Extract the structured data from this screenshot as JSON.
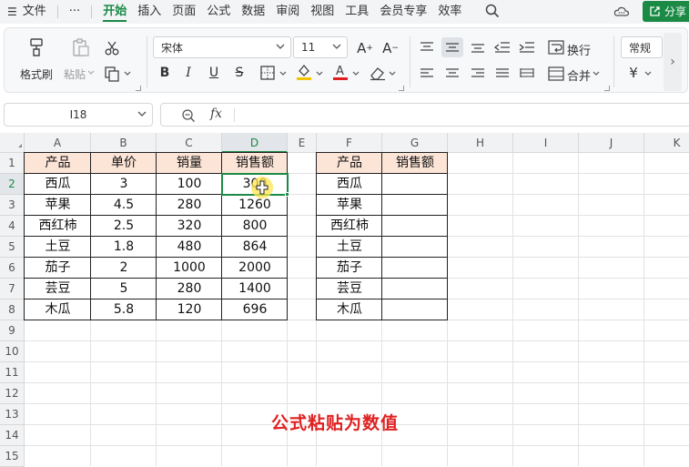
{
  "menu": {
    "file_label": "文件",
    "more_label": "···",
    "tabs": [
      "开始",
      "插入",
      "页面",
      "公式",
      "数据",
      "审阅",
      "视图",
      "工具",
      "会员专享",
      "效率"
    ],
    "active_tab": "开始",
    "share_label": "分享"
  },
  "ribbon": {
    "format_painter": "格式刷",
    "paste": "粘贴",
    "font_name": "宋体",
    "font_size": "11",
    "wrap": "换行",
    "merge": "合并",
    "number_format": "常规",
    "currency_symbol": "¥",
    "font_color": "#e02020",
    "fill_color": "#f5c400"
  },
  "formula_bar": {
    "cell_ref": "I18",
    "fx_label": "fx",
    "formula": ""
  },
  "grid": {
    "columns": [
      "A",
      "B",
      "C",
      "D",
      "E",
      "F",
      "G",
      "H",
      "I",
      "J",
      "K"
    ],
    "rows": [
      "1",
      "2",
      "3",
      "4",
      "5",
      "6",
      "7",
      "8",
      "9",
      "10",
      "11",
      "12",
      "13",
      "14",
      "15"
    ],
    "selected_column": "D",
    "selected_row": "2"
  },
  "table1": {
    "headers": [
      "产品",
      "单价",
      "销量",
      "销售额"
    ],
    "rows": [
      [
        "西瓜",
        "3",
        "100",
        "300"
      ],
      [
        "苹果",
        "4.5",
        "280",
        "1260"
      ],
      [
        "西红柿",
        "2.5",
        "320",
        "800"
      ],
      [
        "土豆",
        "1.8",
        "480",
        "864"
      ],
      [
        "茄子",
        "2",
        "1000",
        "2000"
      ],
      [
        "芸豆",
        "5",
        "280",
        "1400"
      ],
      [
        "木瓜",
        "5.8",
        "120",
        "696"
      ]
    ]
  },
  "table2": {
    "headers": [
      "产品",
      "销售额"
    ],
    "rows": [
      [
        "西瓜",
        ""
      ],
      [
        "苹果",
        ""
      ],
      [
        "西红柿",
        ""
      ],
      [
        "土豆",
        ""
      ],
      [
        "茄子",
        ""
      ],
      [
        "芸豆",
        ""
      ],
      [
        "木瓜",
        ""
      ]
    ]
  },
  "caption": "公式粘贴为数值",
  "colors": {
    "accent": "#1a8a45",
    "header_fill": "#fce4d6",
    "caption": "#e02020"
  }
}
